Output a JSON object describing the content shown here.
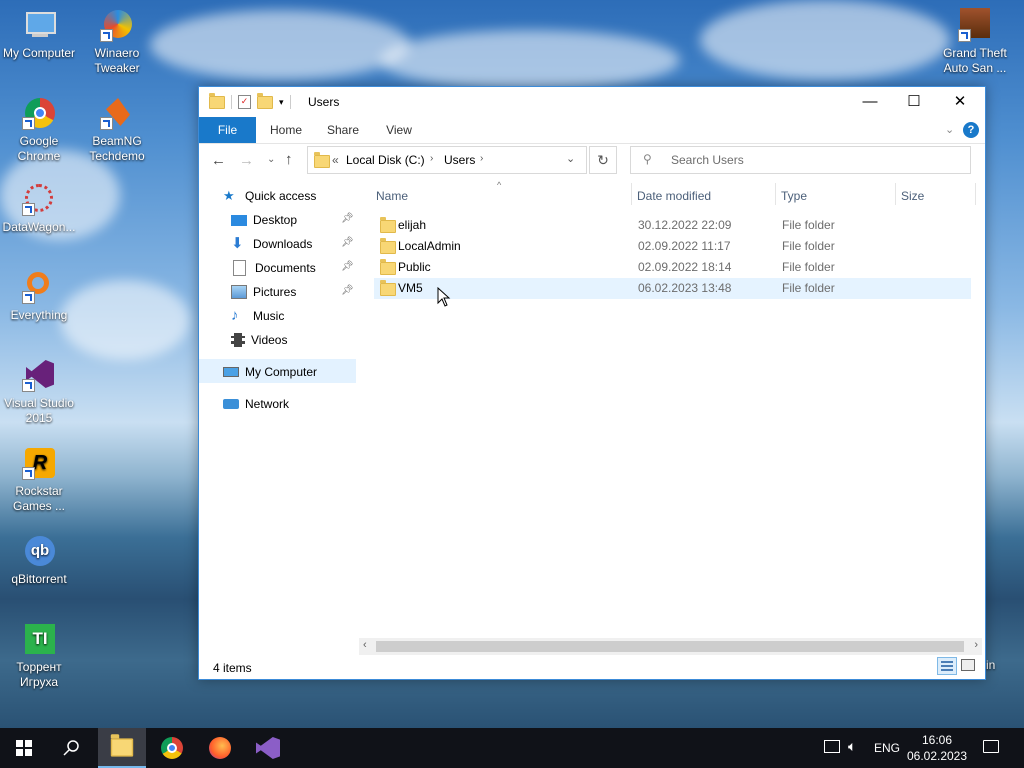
{
  "desktop": {
    "icons": [
      {
        "label": "My Computer"
      },
      {
        "label": "Winaero Tweaker"
      },
      {
        "label": "Google Chrome"
      },
      {
        "label": "BeamNG Techdemo"
      },
      {
        "label": "DataWagon..."
      },
      {
        "label": "Everything"
      },
      {
        "label": "Visual Studio 2015"
      },
      {
        "label": "Rockstar Games ..."
      },
      {
        "label": "qBittorrent"
      },
      {
        "label": "Торрент Игруха"
      },
      {
        "label": "Grand Theft Auto San ..."
      },
      {
        "label": "Bin"
      }
    ]
  },
  "window": {
    "title": "Users",
    "controls": {
      "minimize": "—",
      "maximize": "☐",
      "close": "✕"
    },
    "ribbon_tabs": [
      "File",
      "Home",
      "Share",
      "View"
    ],
    "help": "?",
    "address": {
      "prefix": "«",
      "path": [
        "Local Disk (C:)",
        "Users"
      ]
    },
    "search_placeholder": "Search Users",
    "nav": [
      {
        "label": "Quick access"
      },
      {
        "label": "Desktop"
      },
      {
        "label": "Downloads"
      },
      {
        "label": "Documents"
      },
      {
        "label": "Pictures"
      },
      {
        "label": "Music"
      },
      {
        "label": "Videos"
      },
      {
        "label": "My Computer"
      },
      {
        "label": "Network"
      }
    ],
    "columns": [
      "Name",
      "Date modified",
      "Type",
      "Size"
    ],
    "rows": [
      {
        "name": "elijah",
        "date": "30.12.2022 22:09",
        "type": "File folder"
      },
      {
        "name": "LocalAdmin",
        "date": "02.09.2022 11:17",
        "type": "File folder"
      },
      {
        "name": "Public",
        "date": "02.09.2022 18:14",
        "type": "File folder"
      },
      {
        "name": "VM5",
        "date": "06.02.2023 13:48",
        "type": "File folder"
      }
    ],
    "status": "4 items"
  },
  "taskbar": {
    "lang": "ENG",
    "time": "16:06",
    "date": "06.02.2023"
  },
  "colors": {
    "accent": "#1979ca",
    "selection": "#e5f3ff",
    "folder": "#f8d775"
  }
}
